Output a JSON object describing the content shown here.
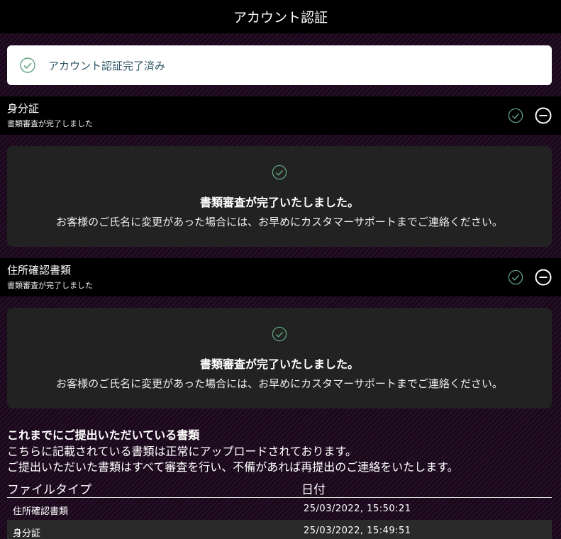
{
  "header": {
    "title": "アカウント認証"
  },
  "status_card": {
    "text": "アカウント認証完了済み"
  },
  "sections": [
    {
      "title": "身分証",
      "subtitle": "書類審査が完了しました",
      "panel_title": "書類審査が完了いたしました。",
      "panel_message": "お客様のご氏名に変更があった場合には、お早めにカスタマーサポートまでご連絡ください。"
    },
    {
      "title": "住所確認書類",
      "subtitle": "書類審査が完了しました",
      "panel_title": "書類審査が完了いたしました。",
      "panel_message": "お客様のご氏名に変更があった場合には、お早めにカスタマーサポートまでご連絡ください。"
    }
  ],
  "documents": {
    "title": "これまでにご提出いただいている書類",
    "line1": "こちらに記載されている書類は正常にアップロードされております。",
    "line2": "ご提出いただいた書類はすべて審査を行い、不備があれば再提出のご連絡をいたします。",
    "columns": [
      "ファイルタイプ",
      "日付"
    ],
    "rows": [
      {
        "type": "住所確認書類",
        "date": "25/03/2022, 15:50:21"
      },
      {
        "type": "身分証",
        "date": "25/03/2022, 15:49:51"
      }
    ]
  },
  "colors": {
    "accent_check": "#5fa381",
    "status_text": "#2e5566"
  },
  "icons": {
    "check": "check-circle-icon",
    "collapse": "minus-circle-icon"
  }
}
